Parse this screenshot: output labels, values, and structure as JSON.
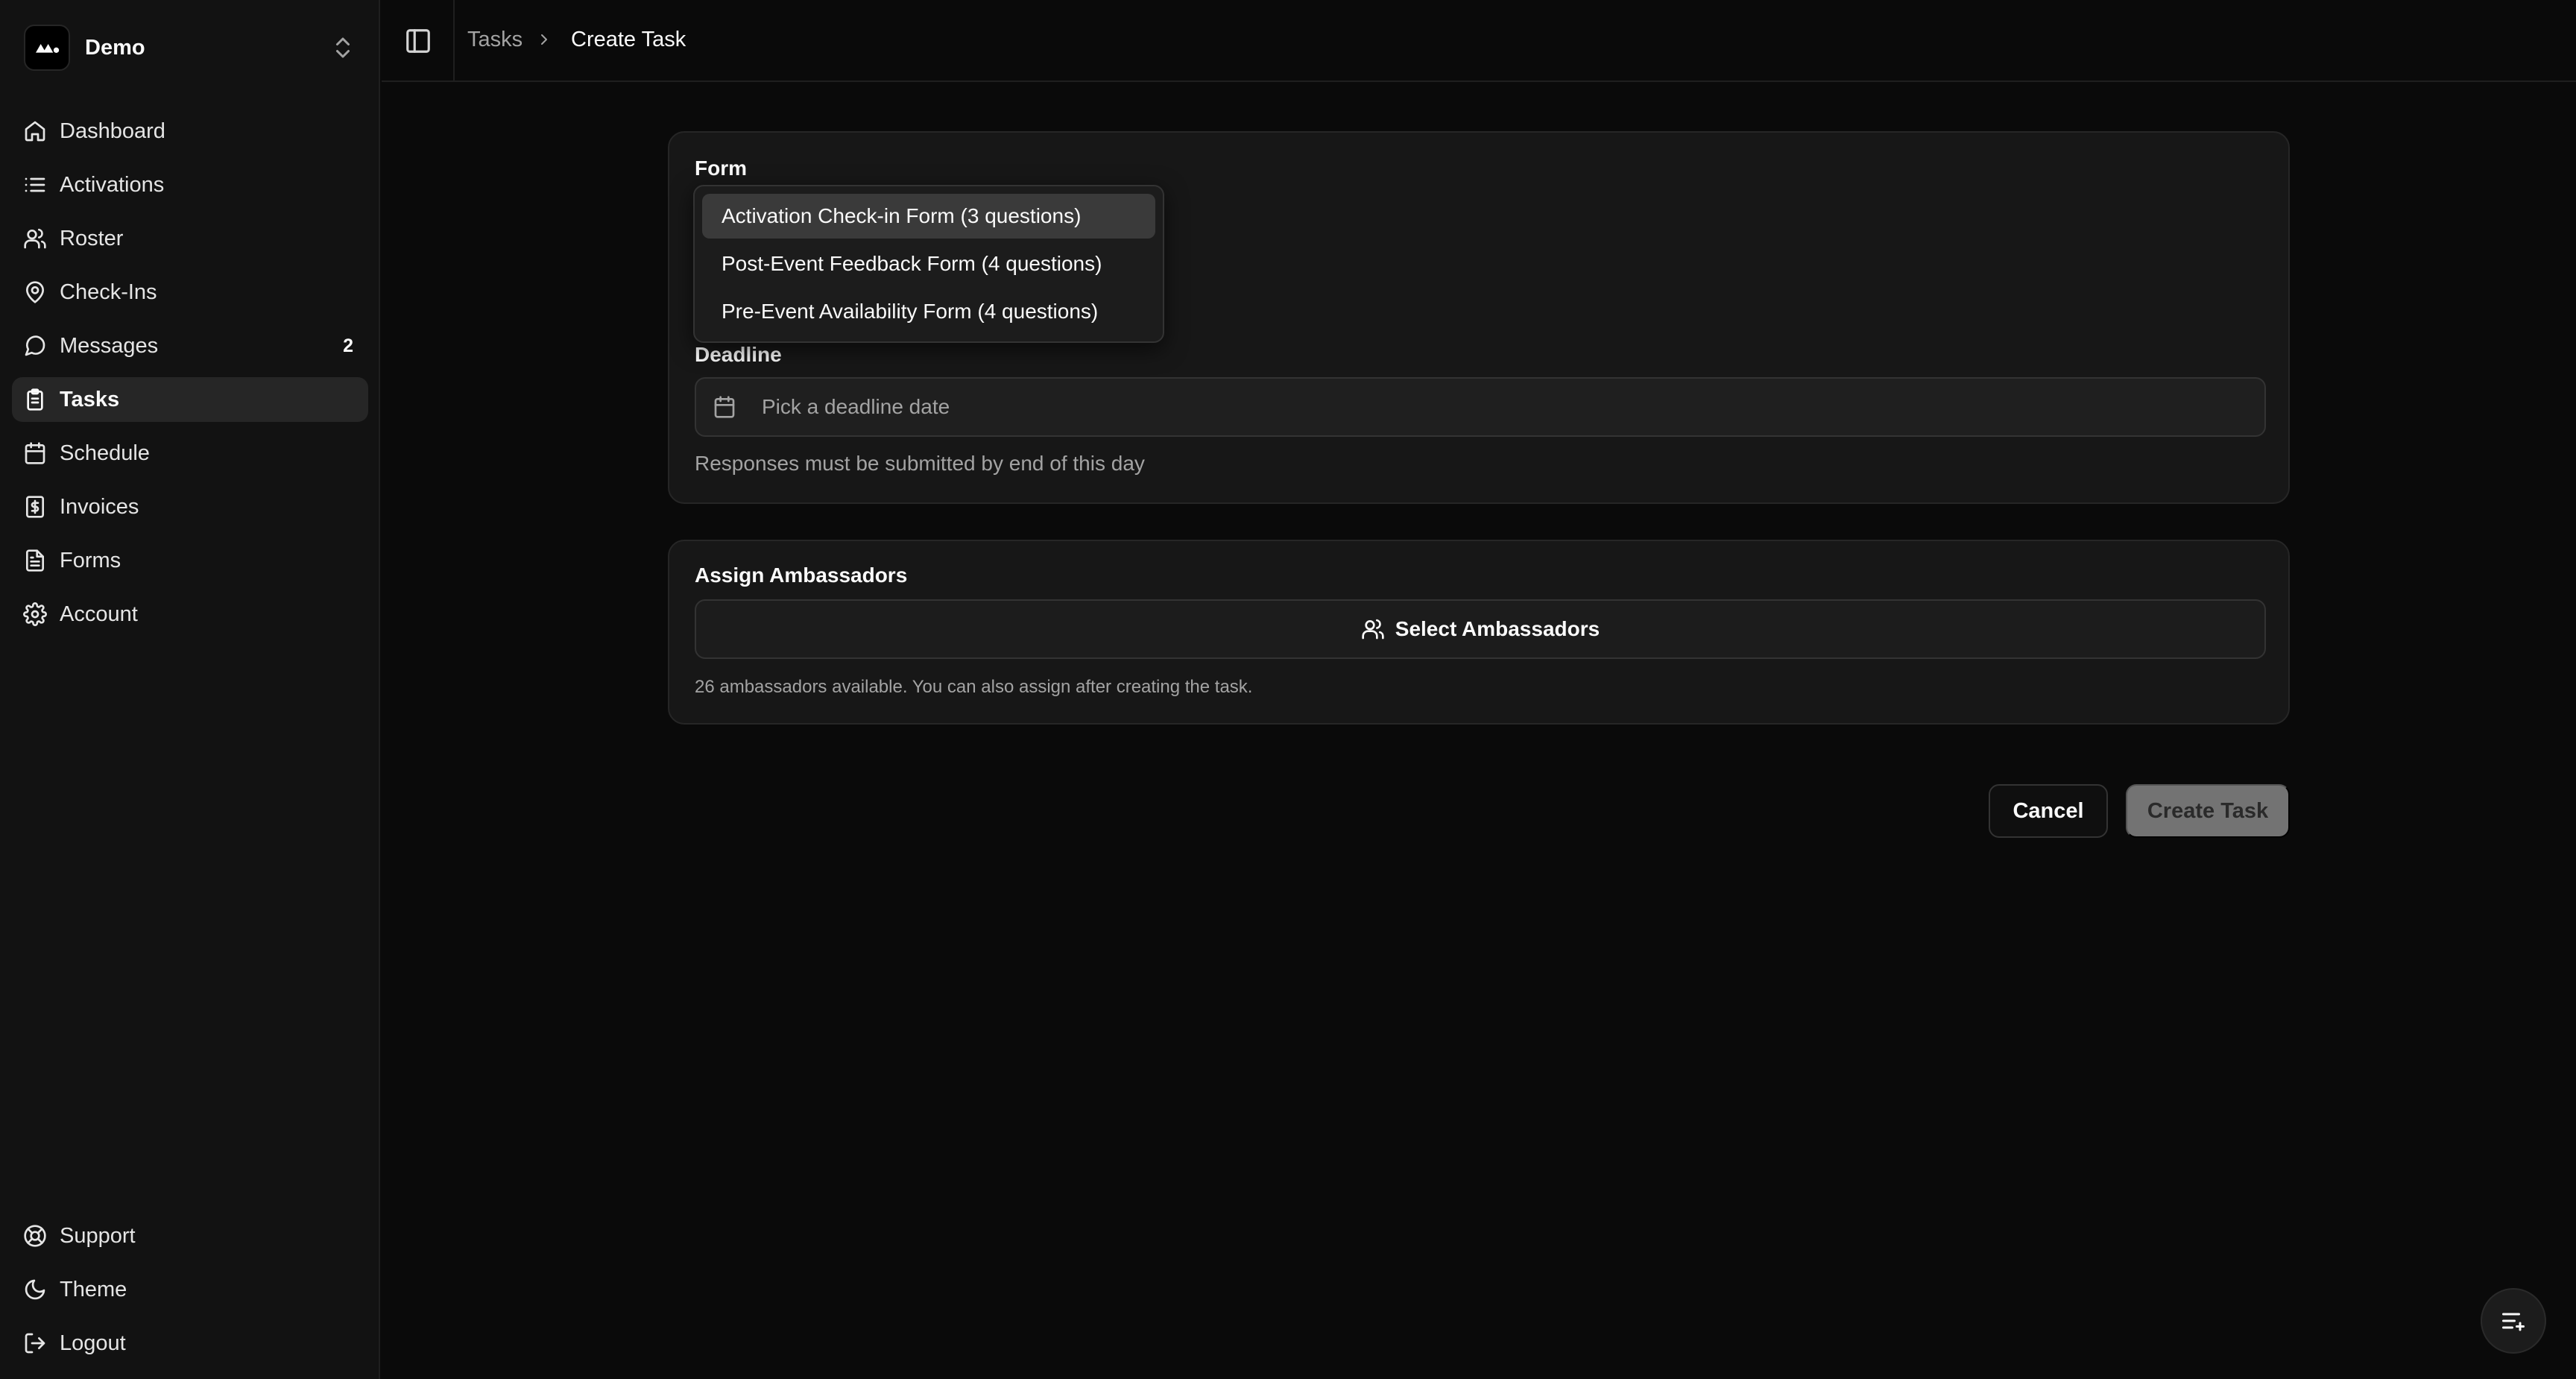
{
  "sidebar": {
    "workspace_name": "Demo",
    "items": [
      {
        "label": "Dashboard"
      },
      {
        "label": "Activations"
      },
      {
        "label": "Roster"
      },
      {
        "label": "Check-Ins"
      },
      {
        "label": "Messages",
        "badge": "2"
      },
      {
        "label": "Tasks",
        "active": true
      },
      {
        "label": "Schedule"
      },
      {
        "label": "Invoices"
      },
      {
        "label": "Forms"
      },
      {
        "label": "Account"
      }
    ],
    "footer": [
      {
        "label": "Support"
      },
      {
        "label": "Theme"
      },
      {
        "label": "Logout"
      }
    ]
  },
  "breadcrumb": {
    "parent": "Tasks",
    "current": "Create Task"
  },
  "form_card": {
    "form_label": "Form",
    "options": [
      "Activation Check-in Form (3 questions)",
      "Post-Event Feedback Form (4 questions)",
      "Pre-Event Availability Form (4 questions)"
    ],
    "deadline_label": "Deadline",
    "deadline_placeholder": "Pick a deadline date",
    "deadline_helper": "Responses must be submitted by end of this day"
  },
  "assign_card": {
    "label": "Assign Ambassadors",
    "button_label": "Select Ambassadors",
    "helper": "26 ambassadors available. You can also assign after creating the task."
  },
  "actions": {
    "cancel": "Cancel",
    "create": "Create Task"
  },
  "icons": {
    "dashboard": "home-icon",
    "activations": "list-icon",
    "roster": "users-icon",
    "checkins": "map-pin-icon",
    "messages": "message-circle-icon",
    "tasks": "clipboard-list-icon",
    "schedule": "calendar-icon",
    "invoices": "receipt-dollar-icon",
    "forms": "file-text-icon",
    "account": "settings-icon",
    "support": "life-buoy-icon",
    "theme": "moon-icon",
    "logout": "log-out-icon"
  }
}
